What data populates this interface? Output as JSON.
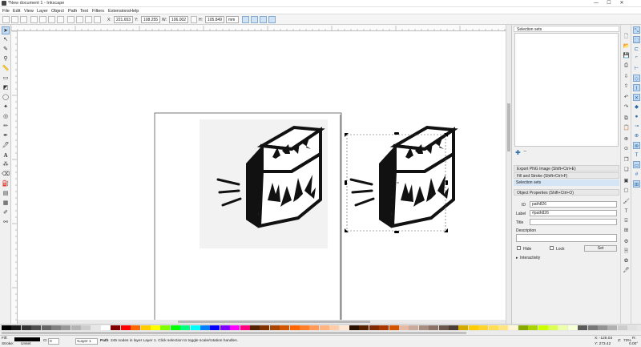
{
  "window": {
    "title": "*New document 1 - Inkscape",
    "min": "—",
    "max": "☐",
    "close": "✕"
  },
  "menu": [
    "File",
    "Edit",
    "View",
    "Layer",
    "Object",
    "Path",
    "Text",
    "Filters",
    "Extensions",
    "Help"
  ],
  "toolctrl": {
    "x_label": "X:",
    "x_value": "221.653",
    "y_label": "Y:",
    "y_value": "108.255",
    "w_label": "W:",
    "w_value": "106.002",
    "h_label": "H:",
    "h_value": "105.849",
    "unit": "mm"
  },
  "tools": [
    "selector-tool",
    "node-tool",
    "tweak-tool",
    "zoom-tool",
    "measure-tool",
    "rect-tool",
    "box3d-tool",
    "ellipse-tool",
    "star-tool",
    "spiral-tool",
    "pencil-tool",
    "pen-tool",
    "calligraphy-tool",
    "text-tool",
    "spray-tool",
    "eraser-tool",
    "paint-bucket-tool",
    "gradient-tool",
    "mesh-tool",
    "dropper-tool",
    "connector-tool"
  ],
  "panel": {
    "selection_sets_title": "Selection sets",
    "dock_items": [
      "Export PNG Image (Shift+Ctrl+E)",
      "Fill and Stroke (Shift+Ctrl+F)",
      "Selection sets",
      "Object Properties (Shift+Ctrl+O)"
    ],
    "id_label": "ID",
    "id_value": "path826",
    "label_label": "Label",
    "label_value": "#path826",
    "title_label": "Title",
    "title_value": "",
    "description_label": "Description",
    "hide_label": "Hide",
    "lock_label": "Lock",
    "set_button": "Set",
    "interactivity_label": "Interactivity"
  },
  "status": {
    "fill_label": "Fill:",
    "stroke_label": "Stroke:",
    "stroke_value": "Unset",
    "opacity_label": "O:",
    "opacity_value": "0",
    "layer_value": "•Layer 1",
    "message_bold": "Path",
    "message": "245 nodes in layer Layer 1. Click selection to toggle scale/rotation handles.",
    "x_coord": "X: -125.03",
    "y_coord": "Y: 273.42",
    "z_label": "Z:",
    "zoom": "73%",
    "r_label": "R:",
    "rotation": "0.00°"
  },
  "colors": {
    "accent": "#c4dcf3",
    "page": "#ffffff",
    "desk": "#ffffff"
  },
  "palette": [
    "#000000",
    "#1a1a1a",
    "#333333",
    "#4d4d4d",
    "#666666",
    "#808080",
    "#999999",
    "#b3b3b3",
    "#cccccc",
    "#e6e6e6",
    "#ffffff",
    "#800000",
    "#ff0000",
    "#ff6600",
    "#ffcc00",
    "#ffff00",
    "#80ff00",
    "#00ff00",
    "#00ff80",
    "#00ffff",
    "#0080ff",
    "#0000ff",
    "#8000ff",
    "#ff00ff",
    "#ff0080",
    "#552200",
    "#803300",
    "#aa4400",
    "#d45500",
    "#ff6600",
    "#ff7f2a",
    "#ff9955",
    "#ffb380",
    "#ffccaa",
    "#ffe6d5",
    "#2b1100",
    "#552200",
    "#802b00",
    "#aa3800",
    "#d45500",
    "#e6b9a5",
    "#c8ab9c",
    "#a58d7f",
    "#8b7367",
    "#6b584d",
    "#4d3e35",
    "#d4aa00",
    "#ffcc00",
    "#ffd42a",
    "#ffdd55",
    "#ffe680",
    "#fff6d5",
    "#88aa00",
    "#aad400",
    "#ccff00",
    "#ddff55",
    "#eeffaa",
    "#f6ffd5",
    "#5a5a5a",
    "#777777",
    "#939393",
    "#b0b0b0",
    "#cccccc",
    "#e0e0e0"
  ]
}
